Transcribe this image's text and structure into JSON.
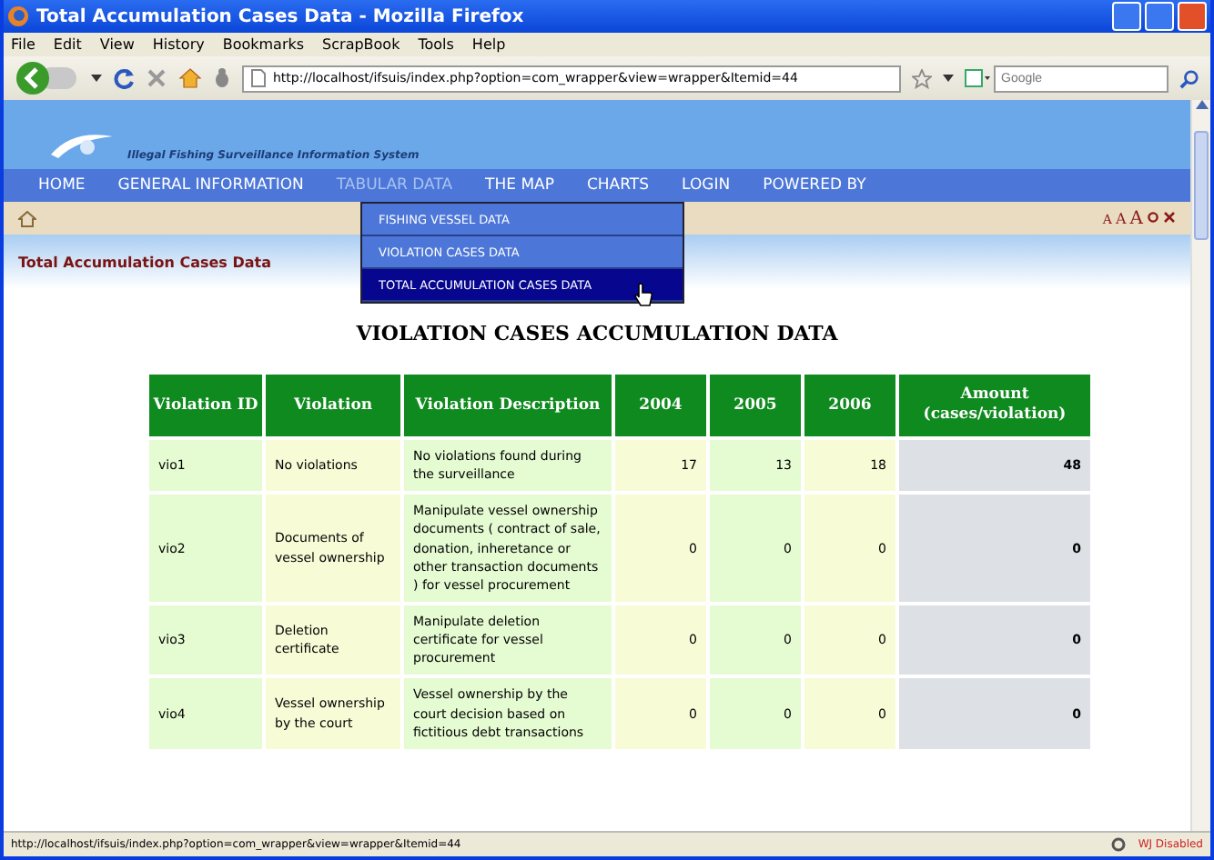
{
  "window": {
    "title": "Total Accumulation Cases Data - Mozilla Firefox"
  },
  "menu": [
    "File",
    "Edit",
    "View",
    "History",
    "Bookmarks",
    "ScrapBook",
    "Tools",
    "Help"
  ],
  "address_bar": {
    "value": "http://localhost/ifsuis/index.php?option=com_wrapper&view=wrapper&Itemid=44"
  },
  "search": {
    "placeholder": "Google"
  },
  "site": {
    "tagline": "Illegal Fishing Surveillance Information System",
    "nav": [
      {
        "label": "HOME",
        "selected": false
      },
      {
        "label": "GENERAL INFORMATION",
        "selected": false
      },
      {
        "label": "TABULAR DATA",
        "selected": true
      },
      {
        "label": "THE MAP",
        "selected": false
      },
      {
        "label": "CHARTS",
        "selected": false
      },
      {
        "label": "LOGIN",
        "selected": false
      },
      {
        "label": "POWERED BY",
        "selected": false
      }
    ],
    "dropdown": [
      {
        "label": "FISHING VESSEL DATA",
        "selected": false
      },
      {
        "label": "VIOLATION CASES DATA",
        "selected": false
      },
      {
        "label": "TOTAL ACCUMULATION CASES DATA",
        "selected": true
      }
    ],
    "font_sizes": [
      "A",
      "A",
      "A"
    ],
    "page_title": "Total Accumulation Cases Data"
  },
  "heading": "VIOLATION CASES ACCUMULATION DATA",
  "table": {
    "columns": [
      "Violation ID",
      "Violation",
      "Violation Description",
      "2004",
      "2005",
      "2006",
      "Amount (cases/violation)"
    ],
    "rows": [
      [
        "vio1",
        "No violations",
        "No violations found during the surveillance",
        "17",
        "13",
        "18",
        "48"
      ],
      [
        "vio2",
        "Documents of vessel ownership",
        "Manipulate vessel ownership documents ( contract of sale, donation, inheretance or other transaction documents ) for vessel procurement",
        "0",
        "0",
        "0",
        "0"
      ],
      [
        "vio3",
        "Deletion certificate",
        "Manipulate deletion certificate for vessel procurement",
        "0",
        "0",
        "0",
        "0"
      ],
      [
        "vio4",
        "Vessel ownership by the court",
        "Vessel ownership by the court decision based on fictitious debt transactions",
        "0",
        "0",
        "0",
        "0"
      ]
    ]
  },
  "status_bar": {
    "url": "http://localhost/ifsuis/index.php?option=com_wrapper&view=wrapper&Itemid=44",
    "addon": "WJ Disabled"
  }
}
